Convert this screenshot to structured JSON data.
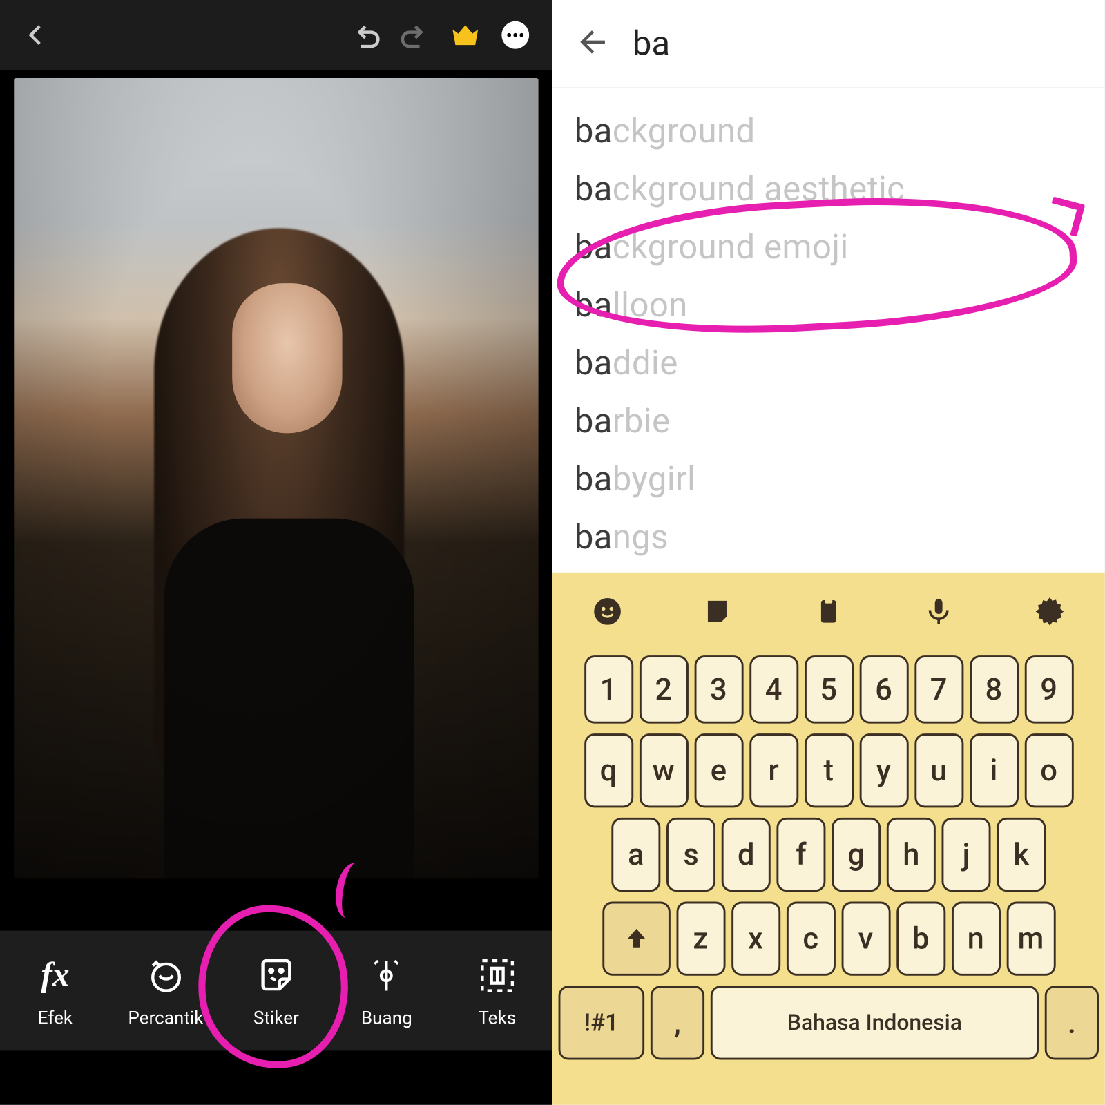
{
  "left": {
    "toolbar": {
      "efek": "Efek",
      "percantik": "Percantik",
      "stiker": "Stiker",
      "buang": "Buang",
      "teks": "Teks"
    }
  },
  "search": {
    "query": "ba",
    "suggestions": [
      {
        "match": "ba",
        "rest": "ckground"
      },
      {
        "match": "ba",
        "rest": "ckground aesthetic"
      },
      {
        "match": "ba",
        "rest": "ckground emoji"
      },
      {
        "match": "ba",
        "rest": "lloon"
      },
      {
        "match": "ba",
        "rest": "ddie"
      },
      {
        "match": "ba",
        "rest": "rbie"
      },
      {
        "match": "ba",
        "rest": "bygirl"
      },
      {
        "match": "ba",
        "rest": "ngs"
      }
    ]
  },
  "keyboard": {
    "row_num": [
      "1",
      "2",
      "3",
      "4",
      "5",
      "6",
      "7",
      "8",
      "9"
    ],
    "row_q": [
      "q",
      "w",
      "e",
      "r",
      "t",
      "y",
      "u",
      "i",
      "o"
    ],
    "row_a": [
      "a",
      "s",
      "d",
      "f",
      "g",
      "h",
      "j",
      "k"
    ],
    "row_z": [
      "z",
      "x",
      "c",
      "v",
      "b",
      "n",
      "m"
    ],
    "sym": "!#1",
    "comma": ",",
    "dot": ".",
    "space_label": "Bahasa Indonesia"
  },
  "annotations": {
    "circled_tool": "Stiker",
    "circled_suggestion": "background emoji"
  }
}
